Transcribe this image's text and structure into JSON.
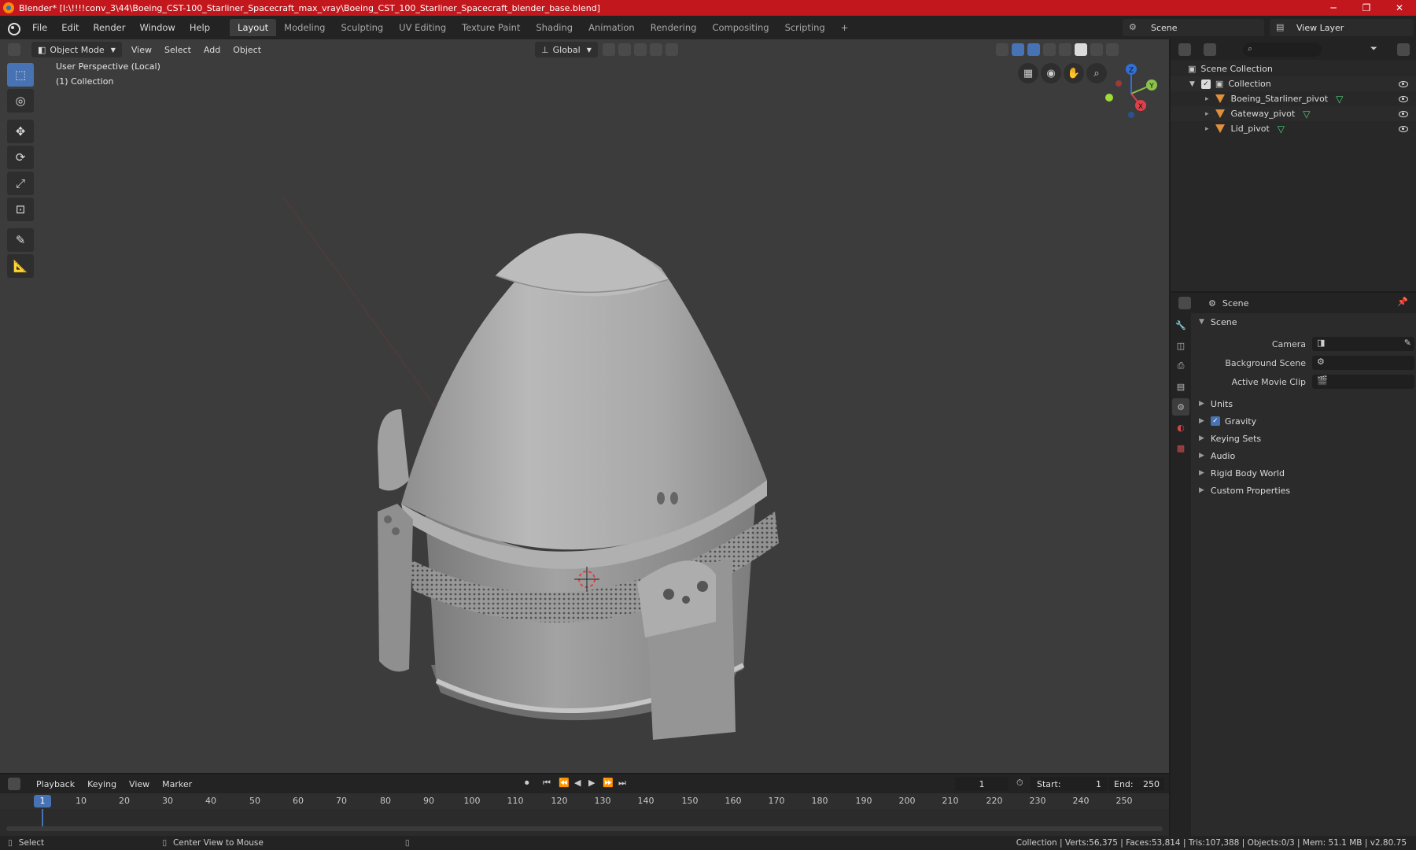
{
  "window": {
    "title": "Blender* [I:\\!!!!conv_3\\44\\Boeing_CST-100_Starliner_Spacecraft_max_vray\\Boeing_CST_100_Starliner_Spacecraft_blender_base.blend]",
    "controls": [
      "─",
      "❐",
      "✕"
    ]
  },
  "menubar": {
    "menus": [
      "File",
      "Edit",
      "Render",
      "Window",
      "Help"
    ],
    "workspaces": [
      "Layout",
      "Modeling",
      "Sculpting",
      "UV Editing",
      "Texture Paint",
      "Shading",
      "Animation",
      "Rendering",
      "Compositing",
      "Scripting"
    ],
    "active_workspace": "Layout",
    "add_tab": "+",
    "scene": "Scene",
    "view_layer": "View Layer"
  },
  "viewport": {
    "mode": "Object Mode",
    "menus": [
      "View",
      "Select",
      "Add",
      "Object"
    ],
    "orientation": "Global",
    "perspective_label": "User Perspective (Local)",
    "collection_label": "(1) Collection",
    "gizmo": {
      "x": "X",
      "y": "Y",
      "z": "Z"
    }
  },
  "outliner": {
    "root": "Scene Collection",
    "collection": "Collection",
    "objects": [
      "Boeing_Starliner_pivot",
      "Gateway_pivot",
      "Lid_pivot"
    ]
  },
  "properties": {
    "header": "Scene",
    "panel": "Scene",
    "fields": [
      "Camera",
      "Background Scene",
      "Active Movie Clip"
    ],
    "sections": [
      "Units",
      "Gravity",
      "Keying Sets",
      "Audio",
      "Rigid Body World",
      "Custom Properties"
    ],
    "gravity_checked": true
  },
  "timeline": {
    "menus": [
      "Playback",
      "Keying",
      "View",
      "Marker"
    ],
    "current_frame": "1",
    "start_label": "Start:",
    "start": "1",
    "end_label": "End:",
    "end": "250",
    "ticks": [
      "1",
      "10",
      "20",
      "30",
      "40",
      "50",
      "60",
      "70",
      "80",
      "90",
      "100",
      "110",
      "120",
      "130",
      "140",
      "150",
      "160",
      "170",
      "180",
      "190",
      "200",
      "210",
      "220",
      "230",
      "240",
      "250"
    ]
  },
  "statusbar": {
    "select": "Select",
    "center": "Center View to Mouse",
    "stats": "Collection | Verts:56,375 | Faces:53,814 | Tris:107,388 | Objects:0/3 | Mem: 51.1 MB | v2.80.75"
  },
  "colors": {
    "titlebar": "#c2171d",
    "accent": "#4772b3",
    "viewport_bg": "#3c3c3c",
    "object_orange": "#e08f3c",
    "mesh_green": "#4fcf7a"
  }
}
